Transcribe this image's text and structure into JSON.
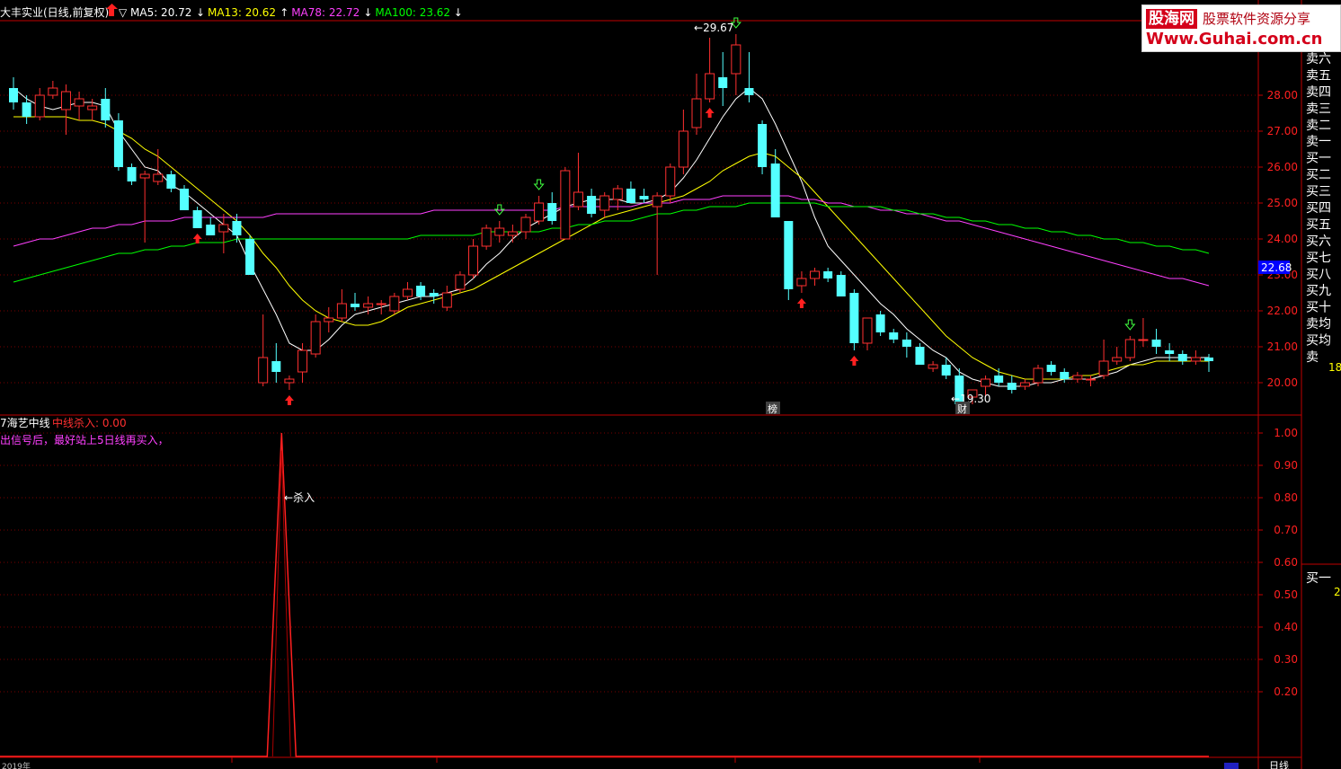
{
  "header": {
    "stock_title": "大丰实业(日线,前复权)",
    "ma_indicators": [
      {
        "label": "MA5: 20.72",
        "color": "#ffffff",
        "arrow": "↓"
      },
      {
        "label": "MA13: 20.62",
        "color": "#ffff00",
        "arrow": "↑"
      },
      {
        "label": "MA78: 22.72",
        "color": "#ff40ff",
        "arrow": "↓"
      },
      {
        "label": "MA100: 23.62",
        "color": "#00ff00",
        "arrow": "↓"
      }
    ],
    "down_marker": "▽"
  },
  "logo": {
    "brand": "股海网",
    "slogan": "股票软件资源分享",
    "url": "Www.Guhai.com.cn"
  },
  "order_book": {
    "sell_labels": [
      "卖六",
      "卖五",
      "卖四",
      "卖三",
      "卖二",
      "卖一"
    ],
    "buy_labels": [
      "买一",
      "买二",
      "买三",
      "买四",
      "买五",
      "买六",
      "买七",
      "买八",
      "买九",
      "买十",
      "卖均",
      "买均"
    ],
    "last_label": "卖",
    "value_18": "18",
    "lower_label": "买一",
    "lower_value": "2"
  },
  "bottom_bar": {
    "period_label": "日线",
    "year_label": "2019年"
  },
  "main_chart": {
    "markers": {
      "high_label": "29.67",
      "low_label": "19.30",
      "bang_label": "榜",
      "cai_label": "财"
    },
    "current_price_label": "22.68",
    "current_price_color": "#0000ff"
  },
  "chart_data": [
    {
      "type": "candlestick",
      "title": "大丰实业(日线,前复权)",
      "y_ticks": [
        "28.00",
        "27.00",
        "26.00",
        "25.00",
        "24.00",
        "23.00",
        "22.00",
        "21.00",
        "20.00"
      ],
      "y_tick_values": [
        28,
        27,
        26,
        25,
        24,
        23,
        22,
        21,
        20
      ],
      "ylim": [
        19.2,
        29.9
      ],
      "candles": [
        [
          28.2,
          28.5,
          27.6,
          27.8
        ],
        [
          27.8,
          28.0,
          27.2,
          27.4
        ],
        [
          27.4,
          28.2,
          27.3,
          28.0
        ],
        [
          28.0,
          28.4,
          27.9,
          28.2
        ],
        [
          27.6,
          28.3,
          26.9,
          28.1
        ],
        [
          27.7,
          28.1,
          27.3,
          27.9
        ],
        [
          27.6,
          27.9,
          27.3,
          27.7
        ],
        [
          27.9,
          28.2,
          27.1,
          27.3
        ],
        [
          27.3,
          27.5,
          25.9,
          26.0
        ],
        [
          26.0,
          26.1,
          25.5,
          25.6
        ],
        [
          25.7,
          25.9,
          23.9,
          25.8
        ],
        [
          25.6,
          26.5,
          25.5,
          25.8
        ],
        [
          25.8,
          25.9,
          25.3,
          25.4
        ],
        [
          25.4,
          25.5,
          24.8,
          24.8
        ],
        [
          24.8,
          24.9,
          24.3,
          24.3
        ],
        [
          24.4,
          24.6,
          24.1,
          24.1
        ],
        [
          24.2,
          24.7,
          23.6,
          24.4
        ],
        [
          24.5,
          24.7,
          23.9,
          24.1
        ],
        [
          24.0,
          24.1,
          23.0,
          23.0
        ],
        [
          20.0,
          21.9,
          19.9,
          20.7
        ],
        [
          20.6,
          21.1,
          20.0,
          20.3
        ],
        [
          20.0,
          20.2,
          19.8,
          20.1
        ],
        [
          20.3,
          21.1,
          20.0,
          20.9
        ],
        [
          20.8,
          21.9,
          20.7,
          21.7
        ],
        [
          21.7,
          22.1,
          21.4,
          21.8
        ],
        [
          21.8,
          22.6,
          21.7,
          22.2
        ],
        [
          22.2,
          22.5,
          22.0,
          22.1
        ],
        [
          22.1,
          22.4,
          21.9,
          22.2
        ],
        [
          22.2,
          22.3,
          21.9,
          22.2
        ],
        [
          22.0,
          22.5,
          21.9,
          22.4
        ],
        [
          22.4,
          22.8,
          22.3,
          22.6
        ],
        [
          22.7,
          22.8,
          22.3,
          22.4
        ],
        [
          22.5,
          22.6,
          22.2,
          22.4
        ],
        [
          22.1,
          22.7,
          22.0,
          22.5
        ],
        [
          22.6,
          23.1,
          22.5,
          23.0
        ],
        [
          23.0,
          24.0,
          22.9,
          23.8
        ],
        [
          23.8,
          24.4,
          23.7,
          24.3
        ],
        [
          24.1,
          24.5,
          23.9,
          24.3
        ],
        [
          24.1,
          24.4,
          23.9,
          24.2
        ],
        [
          24.2,
          24.7,
          24.0,
          24.6
        ],
        [
          24.5,
          25.2,
          24.4,
          25.0
        ],
        [
          25.0,
          25.3,
          24.4,
          24.5
        ],
        [
          24.0,
          26.0,
          24.0,
          25.9
        ],
        [
          24.9,
          26.4,
          24.8,
          25.3
        ],
        [
          25.2,
          25.4,
          24.6,
          24.7
        ],
        [
          24.8,
          25.3,
          24.6,
          25.2
        ],
        [
          25.1,
          25.5,
          24.8,
          25.4
        ],
        [
          25.4,
          25.6,
          25.1,
          25.0
        ],
        [
          25.2,
          25.4,
          25.0,
          25.1
        ],
        [
          24.9,
          25.3,
          23.0,
          25.2
        ],
        [
          25.2,
          26.1,
          25.0,
          26.0
        ],
        [
          26.0,
          27.6,
          25.8,
          27.0
        ],
        [
          27.1,
          28.6,
          26.9,
          27.9
        ],
        [
          27.9,
          29.6,
          27.8,
          28.6
        ],
        [
          28.5,
          29.2,
          27.7,
          28.2
        ],
        [
          28.6,
          29.7,
          28.0,
          29.4
        ],
        [
          28.2,
          29.2,
          27.8,
          28.0
        ],
        [
          27.2,
          27.3,
          25.8,
          26.0
        ],
        [
          26.1,
          26.5,
          24.6,
          24.6
        ],
        [
          24.5,
          24.5,
          22.3,
          22.6
        ],
        [
          22.7,
          23.1,
          22.5,
          22.9
        ],
        [
          22.9,
          23.2,
          22.7,
          23.1
        ],
        [
          23.1,
          23.2,
          22.8,
          22.9
        ],
        [
          23.0,
          23.1,
          22.4,
          22.4
        ],
        [
          22.5,
          22.6,
          20.9,
          21.1
        ],
        [
          21.1,
          21.8,
          20.9,
          21.8
        ],
        [
          21.9,
          22.0,
          21.3,
          21.4
        ],
        [
          21.4,
          21.5,
          21.1,
          21.2
        ],
        [
          21.2,
          21.4,
          20.7,
          21.0
        ],
        [
          21.0,
          21.1,
          20.5,
          20.5
        ],
        [
          20.4,
          20.6,
          20.3,
          20.5
        ],
        [
          20.5,
          20.7,
          20.1,
          20.2
        ],
        [
          20.2,
          20.4,
          19.4,
          19.4
        ],
        [
          19.6,
          19.8,
          19.4,
          19.8
        ],
        [
          19.9,
          20.2,
          19.6,
          20.1
        ],
        [
          20.2,
          20.4,
          19.9,
          20.0
        ],
        [
          20.0,
          20.2,
          19.7,
          19.8
        ],
        [
          19.9,
          20.1,
          19.8,
          20.0
        ],
        [
          20.0,
          20.5,
          19.9,
          20.4
        ],
        [
          20.5,
          20.6,
          20.2,
          20.3
        ],
        [
          20.3,
          20.4,
          20.0,
          20.1
        ],
        [
          20.1,
          20.3,
          20.0,
          20.2
        ],
        [
          20.1,
          20.2,
          19.9,
          20.1
        ],
        [
          20.2,
          21.2,
          20.1,
          20.6
        ],
        [
          20.6,
          21.0,
          20.5,
          20.7
        ],
        [
          20.7,
          21.3,
          20.6,
          21.2
        ],
        [
          21.2,
          21.8,
          21.0,
          21.2
        ],
        [
          21.2,
          21.5,
          20.8,
          21.0
        ],
        [
          20.9,
          21.1,
          20.6,
          20.8
        ],
        [
          20.8,
          20.9,
          20.5,
          20.6
        ],
        [
          20.6,
          20.9,
          20.5,
          20.7
        ],
        [
          20.7,
          20.8,
          20.3,
          20.6
        ]
      ],
      "series": [
        {
          "name": "MA5",
          "color": "#ffffff",
          "values": [
            28.2,
            27.9,
            27.7,
            27.6,
            27.7,
            27.8,
            27.8,
            27.7,
            27.0,
            26.5,
            26.0,
            25.9,
            25.5,
            25.3,
            25.0,
            24.7,
            24.4,
            24.1,
            23.3,
            22.6,
            21.9,
            21.1,
            20.9,
            20.9,
            21.2,
            21.6,
            21.9,
            22.0,
            22.1,
            22.2,
            22.3,
            22.4,
            22.4,
            22.5,
            22.6,
            22.9,
            23.3,
            23.6,
            24.0,
            24.3,
            24.5,
            24.7,
            24.9,
            25.0,
            25.1,
            25.1,
            25.1,
            25.0,
            25.0,
            25.1,
            25.3,
            25.7,
            26.2,
            26.8,
            27.4,
            27.9,
            28.2,
            27.9,
            27.2,
            26.4,
            25.6,
            24.6,
            23.8,
            23.4,
            23.0,
            22.6,
            22.2,
            21.9,
            21.5,
            21.2,
            20.9,
            20.7,
            20.3,
            20.1,
            20.0,
            19.9,
            19.9,
            19.9,
            20.0,
            20.0,
            20.1,
            20.1,
            20.1,
            20.2,
            20.3,
            20.5,
            20.6,
            20.7,
            20.7,
            20.7,
            20.7,
            20.7
          ]
        },
        {
          "name": "MA13",
          "color": "#ffff00",
          "values": [
            27.4,
            27.4,
            27.4,
            27.4,
            27.4,
            27.3,
            27.3,
            27.2,
            27.0,
            26.8,
            26.5,
            26.3,
            26.0,
            25.7,
            25.4,
            25.1,
            24.8,
            24.5,
            24.1,
            23.6,
            23.2,
            22.7,
            22.3,
            22.0,
            21.8,
            21.7,
            21.6,
            21.6,
            21.7,
            21.9,
            22.1,
            22.2,
            22.3,
            22.4,
            22.5,
            22.6,
            22.8,
            23.0,
            23.2,
            23.4,
            23.6,
            23.8,
            24.0,
            24.2,
            24.4,
            24.6,
            24.7,
            24.8,
            24.9,
            25.0,
            25.1,
            25.2,
            25.4,
            25.6,
            25.9,
            26.1,
            26.3,
            26.4,
            26.3,
            26.0,
            25.7,
            25.3,
            24.9,
            24.5,
            24.1,
            23.7,
            23.3,
            22.9,
            22.5,
            22.1,
            21.7,
            21.3,
            21.0,
            20.7,
            20.5,
            20.3,
            20.2,
            20.1,
            20.1,
            20.1,
            20.1,
            20.2,
            20.2,
            20.3,
            20.4,
            20.5,
            20.5,
            20.6,
            20.6,
            20.6,
            20.6,
            20.6
          ]
        },
        {
          "name": "MA78",
          "color": "#ff40ff",
          "values": [
            23.8,
            23.9,
            24.0,
            24.0,
            24.1,
            24.2,
            24.3,
            24.3,
            24.4,
            24.4,
            24.5,
            24.5,
            24.5,
            24.6,
            24.6,
            24.6,
            24.6,
            24.6,
            24.6,
            24.6,
            24.7,
            24.7,
            24.7,
            24.7,
            24.7,
            24.7,
            24.7,
            24.7,
            24.7,
            24.7,
            24.7,
            24.7,
            24.8,
            24.8,
            24.8,
            24.8,
            24.8,
            24.8,
            24.8,
            24.8,
            24.8,
            24.8,
            24.9,
            24.9,
            24.9,
            24.9,
            24.9,
            24.9,
            25.0,
            25.0,
            25.0,
            25.1,
            25.1,
            25.1,
            25.2,
            25.2,
            25.2,
            25.2,
            25.2,
            25.2,
            25.1,
            25.1,
            25.0,
            25.0,
            24.9,
            24.9,
            24.8,
            24.8,
            24.7,
            24.7,
            24.6,
            24.5,
            24.5,
            24.4,
            24.3,
            24.2,
            24.1,
            24.0,
            23.9,
            23.8,
            23.7,
            23.6,
            23.5,
            23.4,
            23.3,
            23.2,
            23.1,
            23.0,
            22.9,
            22.9,
            22.8,
            22.7
          ]
        },
        {
          "name": "MA100",
          "color": "#00ff00",
          "values": [
            22.8,
            22.9,
            23.0,
            23.1,
            23.2,
            23.3,
            23.4,
            23.5,
            23.6,
            23.6,
            23.7,
            23.7,
            23.8,
            23.8,
            23.9,
            23.9,
            23.9,
            24.0,
            24.0,
            24.0,
            24.0,
            24.0,
            24.0,
            24.0,
            24.0,
            24.0,
            24.0,
            24.0,
            24.0,
            24.0,
            24.0,
            24.1,
            24.1,
            24.1,
            24.1,
            24.1,
            24.2,
            24.2,
            24.2,
            24.2,
            24.2,
            24.3,
            24.3,
            24.4,
            24.4,
            24.5,
            24.5,
            24.5,
            24.6,
            24.7,
            24.7,
            24.8,
            24.8,
            24.9,
            24.9,
            24.9,
            25.0,
            25.0,
            25.0,
            25.0,
            25.0,
            25.0,
            24.9,
            24.9,
            24.9,
            24.9,
            24.9,
            24.8,
            24.8,
            24.7,
            24.7,
            24.6,
            24.6,
            24.5,
            24.5,
            24.4,
            24.4,
            24.3,
            24.3,
            24.2,
            24.2,
            24.1,
            24.1,
            24.0,
            24.0,
            23.9,
            23.9,
            23.8,
            23.8,
            23.7,
            23.7,
            23.6
          ]
        }
      ],
      "buy_signals": [
        14,
        21,
        53,
        60,
        64
      ],
      "sell_signals": [
        37,
        40,
        55,
        85
      ]
    },
    {
      "type": "line",
      "title": "海艺中线",
      "indicator_label": "中线杀入: 0.00",
      "note": "出信号后，最好站上5日线再买入，",
      "y_ticks": [
        "1.00",
        "0.90",
        "0.80",
        "0.70",
        "0.60",
        "0.50",
        "0.40",
        "0.30",
        "0.20"
      ],
      "y_tick_values": [
        1.0,
        0.9,
        0.8,
        0.7,
        0.6,
        0.5,
        0.4,
        0.3,
        0.2
      ],
      "ylim": [
        0.0,
        1.0
      ],
      "series": [
        {
          "name": "中线杀入",
          "color": "#ff2020",
          "spike_index": 20,
          "spike_value": 1.0
        }
      ],
      "annotation": "杀入"
    }
  ]
}
